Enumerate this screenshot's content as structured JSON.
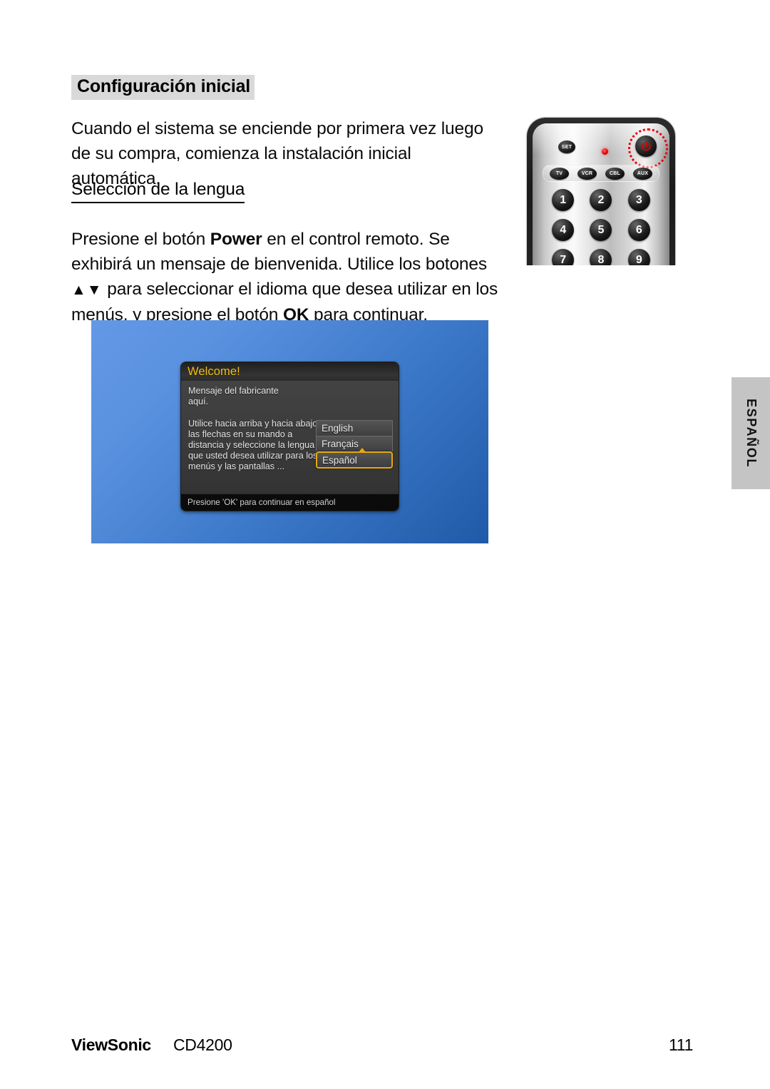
{
  "page": {
    "heading": "Configuración inicial",
    "intro_paragraph": "Cuando el sistema se enciende por primera vez luego de su compra, comienza la instalación inicial automática.",
    "subheading": "Selección de la lengua",
    "instructions": {
      "part1": "Presione el botón ",
      "bold1": "Power",
      "part2": " en el control remoto. Se exhibirá un mensaje de bienvenida. Utilice los botones ",
      "arrows": "▲▼",
      "part3": " para seleccionar el idioma que desea utilizar en los menús, y presione el botón ",
      "bold2": "OK",
      "part4": " para continuar."
    }
  },
  "remote": {
    "set_button": "SET",
    "power_glyph": "⏻",
    "mode_buttons": [
      "TV",
      "VCR",
      "CBL",
      "AUX"
    ],
    "keypad": [
      "1",
      "2",
      "3",
      "4",
      "5",
      "6",
      "7",
      "8",
      "9"
    ],
    "highlight_color": "#ee0000"
  },
  "screenshot": {
    "panel_gradient_from": "#5a92e0",
    "panel_gradient_to": "#1f5aa8",
    "osd": {
      "title": "Welcome!",
      "title_color": "#f5c016",
      "body_text": "Mensaje del fabricante\naquí.\n\nUtilice hacia arriba y hacia abajo las flechas en su mando a distancia y seleccione la lengua que usted desea utilizar para los menús y las pantallas ...",
      "languages": [
        {
          "label": "English",
          "selected": false
        },
        {
          "label": "Français",
          "selected": false
        },
        {
          "label": "Español",
          "selected": true
        }
      ],
      "selected_border_color": "#e8a80e",
      "footer": "Presione 'OK' para continuar en español"
    }
  },
  "side_tab": {
    "label": "ESPAÑOL"
  },
  "footer": {
    "brand": "ViewSonic",
    "model": "CD4200",
    "page_number": "111"
  }
}
